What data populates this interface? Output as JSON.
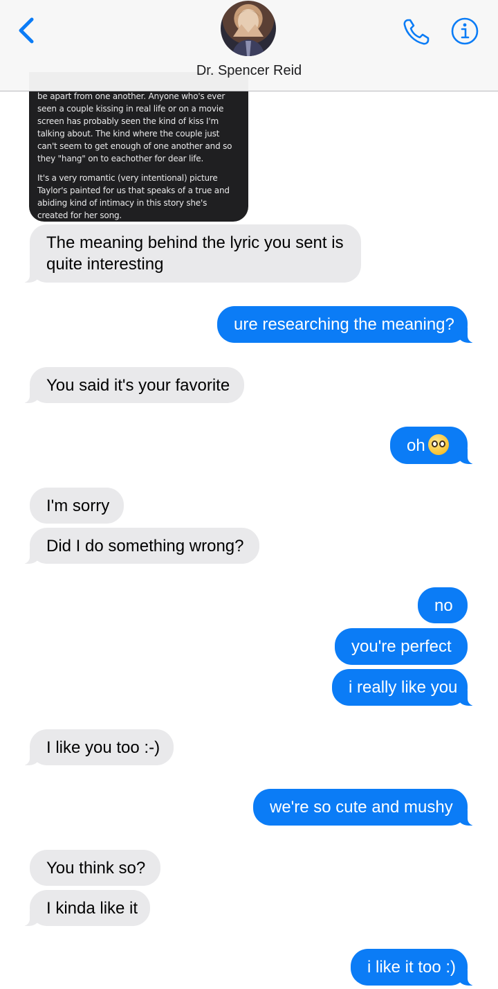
{
  "header": {
    "contact_name": "Dr. Spencer Reid",
    "back_icon": "chevron-left-icon",
    "call_icon": "phone-icon",
    "info_icon": "info-icon",
    "accent_color": "#0b7cf6"
  },
  "attachment": {
    "paragraphs": [
      "be apart from one another. Anyone who's ever seen a couple kissing in real life or on a movie screen has probably seen the kind of kiss I'm talking about. The kind where the couple just can't seem to get enough of one another and so they \"hang\" on to eachother for dear life.",
      "It's a very romantic (very intentional) picture Taylor's painted for us that speaks of a true and abiding kind of intimacy in this story she's created for her song."
    ]
  },
  "messages": [
    {
      "from": "them",
      "text": "The meaning behind the lyric you sent is quite interesting"
    },
    {
      "from": "me",
      "text": "ure researching the meaning?"
    },
    {
      "from": "them",
      "text": "You said it's your favorite"
    },
    {
      "from": "me",
      "text": "oh",
      "emoji": "pleading-face-emoji"
    },
    {
      "from": "them",
      "text": "I'm sorry"
    },
    {
      "from": "them",
      "text": "Did I do something wrong?"
    },
    {
      "from": "me",
      "text": "no"
    },
    {
      "from": "me",
      "text": "you're perfect"
    },
    {
      "from": "me",
      "text": "i really like you"
    },
    {
      "from": "them",
      "text": "I like you too :-)"
    },
    {
      "from": "me",
      "text": "we're so cute and mushy"
    },
    {
      "from": "them",
      "text": "You think so?"
    },
    {
      "from": "them",
      "text": "I kinda like it"
    },
    {
      "from": "me",
      "text": "i like it too :)"
    }
  ]
}
